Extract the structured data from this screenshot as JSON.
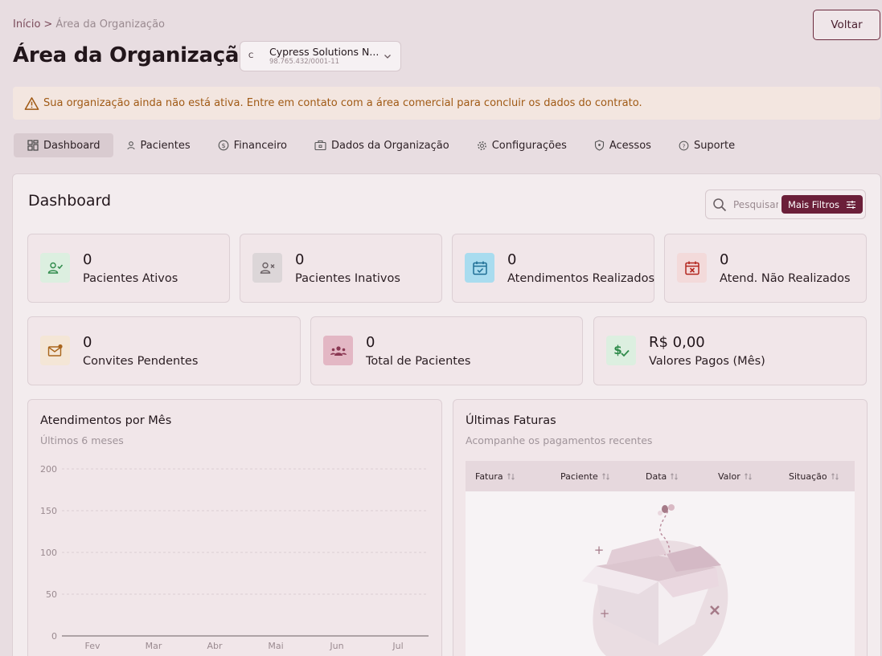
{
  "breadcrumb": {
    "home": "Início",
    "separator": ">",
    "current": "Área da Organização"
  },
  "page_title": "Área da Organização",
  "org": {
    "initial": "C",
    "name": "Cypress Solutions N...",
    "cnpj": "98.765.432/0001-11"
  },
  "back_label": "Voltar",
  "alert_text": "Sua organização ainda não está ativa. Entre em contato com a área comercial para concluir os dados do contrato.",
  "tabs": [
    {
      "label": "Dashboard",
      "icon": "grid-icon"
    },
    {
      "label": "Pacientes",
      "icon": "user-icon"
    },
    {
      "label": "Financeiro",
      "icon": "dollar-circle-icon"
    },
    {
      "label": "Dados da Organização",
      "icon": "briefcase-icon"
    },
    {
      "label": "Configurações",
      "icon": "gear-icon"
    },
    {
      "label": "Acessos",
      "icon": "shield-icon"
    },
    {
      "label": "Suporte",
      "icon": "help-circle-icon"
    }
  ],
  "dashboard": {
    "title": "Dashboard",
    "search_placeholder": "Pesquisar",
    "filters_label": "Mais Filtros"
  },
  "stats_row1": [
    {
      "value": "0",
      "label": "Pacientes Ativos",
      "icon": "user-check-icon",
      "bg": "#dcefe0",
      "fg": "#2e8a4a"
    },
    {
      "value": "0",
      "label": "Pacientes Inativos",
      "icon": "user-x-icon",
      "bg": "#dcd6d8",
      "fg": "#6a6064"
    },
    {
      "value": "0",
      "label": "Atendimentos Realizados",
      "icon": "calendar-check-icon",
      "bg": "#a9dcef",
      "fg": "#1f6f95"
    },
    {
      "value": "0",
      "label": "Atend. Não Realizados",
      "icon": "calendar-x-icon",
      "bg": "#f3dada",
      "fg": "#b3261e"
    }
  ],
  "stats_row2": [
    {
      "value": "0",
      "label": "Convites Pendentes",
      "icon": "mail-icon",
      "bg": "#f4e6d6",
      "fg": "#a9651c"
    },
    {
      "value": "0",
      "label": "Total de Pacientes",
      "icon": "users-icon",
      "bg": "#e3b7c4",
      "fg": "#8a3752"
    },
    {
      "value": "R$ 0,00",
      "label": "Valores Pagos (Mês)",
      "icon": "dollar-check-icon",
      "bg": "#dcefe0",
      "fg": "#2e8a4a"
    }
  ],
  "chart_title": "Atendimentos por Mês",
  "chart_subtitle": "Últimos 6 meses",
  "chart_data": {
    "type": "line",
    "categories": [
      "Fev",
      "Mar",
      "Abr",
      "Mai",
      "Jun",
      "Jul"
    ],
    "yticks": [
      200,
      150,
      100,
      50,
      0
    ],
    "ylim": [
      0,
      200
    ],
    "series": [
      {
        "values": [
          0,
          0,
          0,
          0,
          0,
          0
        ]
      }
    ],
    "grid": true
  },
  "invoices": {
    "title": "Últimas Faturas",
    "subtitle": "Acompanhe os pagamentos recentes",
    "columns": [
      "Fatura",
      "Paciente",
      "Data",
      "Valor",
      "Situação"
    ],
    "rows": []
  }
}
